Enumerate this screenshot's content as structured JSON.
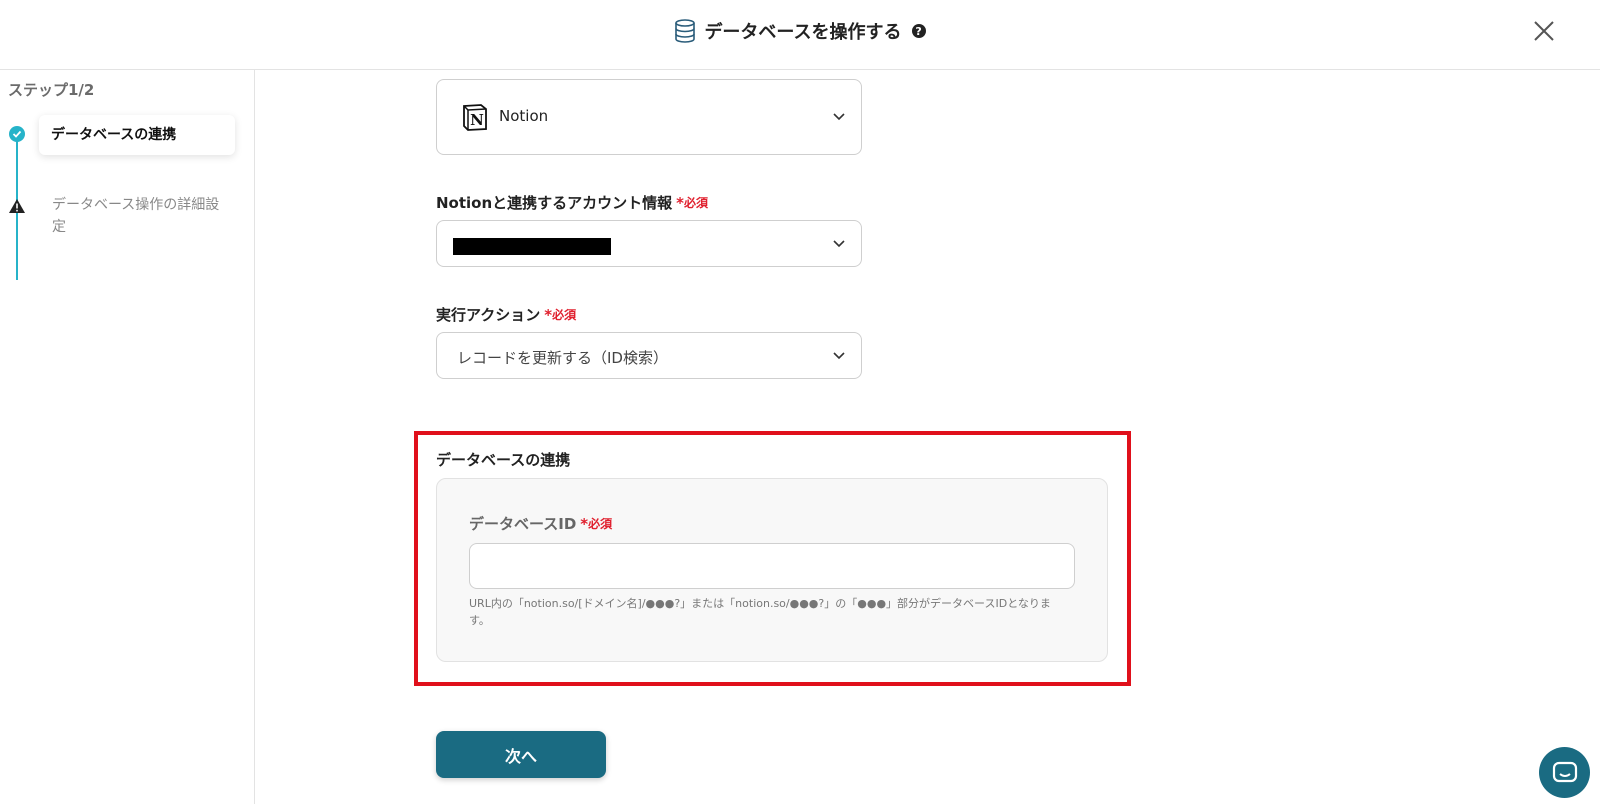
{
  "header": {
    "title": "データベースを操作する",
    "help_icon": "question-circle-icon",
    "close_icon": "close-icon"
  },
  "sidebar": {
    "step_count": "ステップ1/2",
    "steps": [
      {
        "label": "データベースの連携",
        "status": "done"
      },
      {
        "label": "データベース操作の詳細設定",
        "status": "warning"
      }
    ]
  },
  "form": {
    "app": {
      "name": "Notion",
      "icon": "notion-logo-icon"
    },
    "account": {
      "label": "Notionと連携するアカウント情報",
      "required_star": "*",
      "required_text": "必須",
      "value_redacted": true
    },
    "action": {
      "label": "実行アクション",
      "required_star": "*",
      "required_text": "必須",
      "value": "レコードを更新する（ID検索）"
    },
    "db_section": {
      "title": "データベースの連携",
      "db_id_label": "データベースID",
      "required_star": "*",
      "required_text": "必須",
      "db_id_value": "",
      "hint": "URL内の「notion.so/[ドメイン名]/●●●?」または「notion.so/●●●?」の「●●●」部分がデータベースIDとなります。"
    },
    "next_label": "次へ"
  },
  "colors": {
    "accent": "#1a6b82",
    "step_teal": "#26b3c9",
    "required_red": "#e0202e",
    "highlight_red": "#e0101b"
  }
}
